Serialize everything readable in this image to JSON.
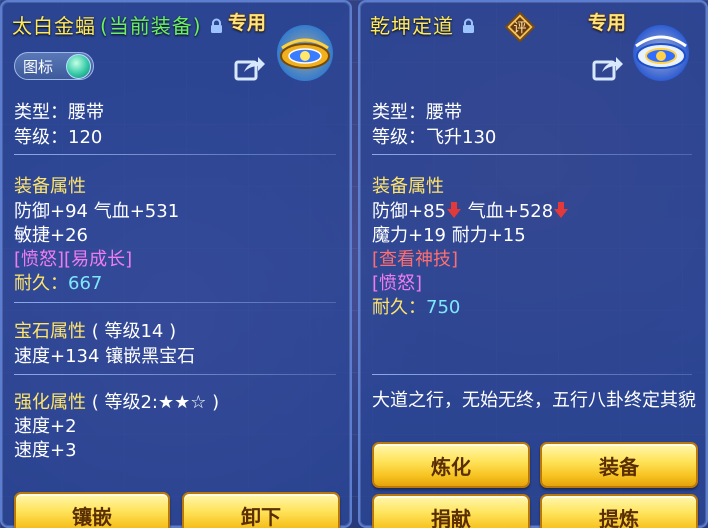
{
  "left": {
    "title_name": "太白金蝠",
    "title_status": "(当前装备)",
    "exclusive": "专用",
    "toggle_label": "图标",
    "type_line": "类型：腰带",
    "level_line": "等级：120",
    "equip_attr_header": "装备属性",
    "defense_hp": "防御+94 气血+531",
    "agility": "敏捷+26",
    "special": "[愤怒][易成长]",
    "durability_label": "耐久：",
    "durability_value": "667",
    "gem_header": "宝石属性",
    "gem_level": "( 等级14 )",
    "gem_detail": "速度+134 镶嵌黑宝石",
    "enhance_header": "强化属性",
    "enhance_level": "( 等级2:★★☆ )",
    "enhance_1": "速度+2",
    "enhance_2": "速度+3",
    "btn_inlay": "镶嵌",
    "btn_unequip": "卸下"
  },
  "right": {
    "title_name": "乾坤定道",
    "eval_badge": "评",
    "exclusive": "专用",
    "type_line": "类型：腰带",
    "level_line": "等级：飞升130",
    "equip_attr_header": "装备属性",
    "defense": "防御+85",
    "hp": "气血+528",
    "magic_endurance": "魔力+19 耐力+15",
    "view_skill": "[查看神技]",
    "special": "[愤怒]",
    "durability_label": "耐久：",
    "durability_value": "750",
    "description": "大道之行，无始无终，五行八卦终定其貌",
    "btn_refine": "炼化",
    "btn_equip": "装备",
    "btn_donate": "捐献",
    "btn_extract": "提炼"
  },
  "colors": {
    "title": "#ffe85a",
    "current_equip": "#6af062",
    "attr_header": "#ffe46a",
    "special": "#f07cf0",
    "view_skill": "#ff6e6e",
    "durability_value": "#7ee8ff",
    "button": "#ffe45c"
  },
  "icons": {
    "lock": "lock-icon",
    "share": "share-icon",
    "down_arrow": "down-arrow-icon",
    "left_equip": "golden-bat-belt-icon",
    "right_equip": "qiankun-belt-icon"
  }
}
